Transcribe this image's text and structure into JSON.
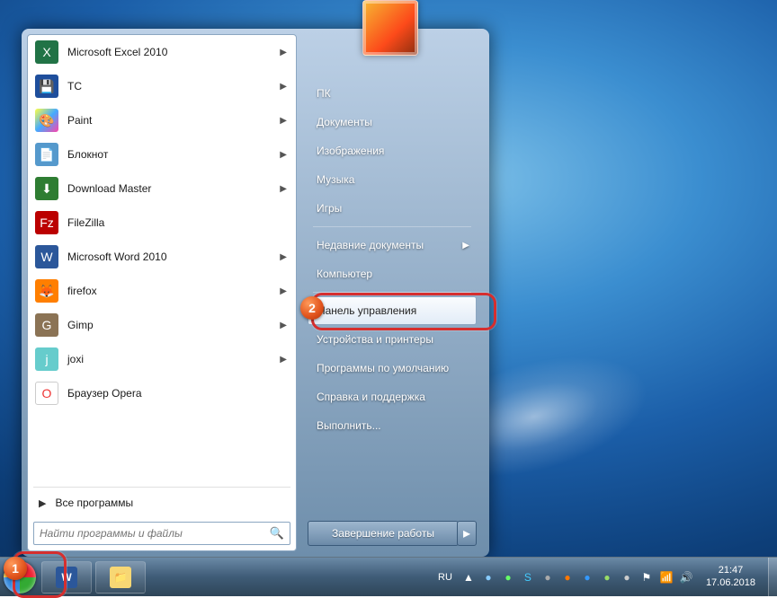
{
  "programs": [
    {
      "label": "Microsoft Excel 2010",
      "icon": "ic-excel",
      "glyph": "X",
      "arrow": true
    },
    {
      "label": "TC",
      "icon": "ic-tc",
      "glyph": "💾",
      "arrow": true
    },
    {
      "label": "Paint",
      "icon": "ic-paint",
      "glyph": "🎨",
      "arrow": true
    },
    {
      "label": "Блокнот",
      "icon": "ic-note",
      "glyph": "📄",
      "arrow": true
    },
    {
      "label": "Download Master",
      "icon": "ic-dm",
      "glyph": "⬇",
      "arrow": true
    },
    {
      "label": "FileZilla",
      "icon": "ic-fz",
      "glyph": "Fz",
      "arrow": false
    },
    {
      "label": "Microsoft Word 2010",
      "icon": "ic-word",
      "glyph": "W",
      "arrow": true
    },
    {
      "label": "firefox",
      "icon": "ic-ff",
      "glyph": "🦊",
      "arrow": true
    },
    {
      "label": "Gimp",
      "icon": "ic-gimp",
      "glyph": "G",
      "arrow": true
    },
    {
      "label": "joxi",
      "icon": "ic-joxi",
      "glyph": "j",
      "arrow": true
    },
    {
      "label": "Браузер Opera",
      "icon": "ic-opera",
      "glyph": "O",
      "arrow": false
    }
  ],
  "all_programs": "Все программы",
  "search_placeholder": "Найти программы и файлы",
  "right_items": [
    {
      "label": "ПК",
      "sep": false
    },
    {
      "label": "Документы",
      "sep": false
    },
    {
      "label": "Изображения",
      "sep": false
    },
    {
      "label": "Музыка",
      "sep": false
    },
    {
      "label": "Игры",
      "sep": true
    },
    {
      "label": "Недавние документы",
      "sep": false,
      "arrow": true
    },
    {
      "label": "Компьютер",
      "sep": true
    },
    {
      "label": "Панель управления",
      "sep": false,
      "hl": true
    },
    {
      "label": "Устройства и принтеры",
      "sep": false
    },
    {
      "label": "Программы по умолчанию",
      "sep": false
    },
    {
      "label": "Справка и поддержка",
      "sep": false
    },
    {
      "label": "Выполнить...",
      "sep": false
    }
  ],
  "shutdown": "Завершение работы",
  "lang": "RU",
  "time": "21:47",
  "date": "17.06.2018",
  "badges": {
    "b1": "1",
    "b2": "2"
  }
}
